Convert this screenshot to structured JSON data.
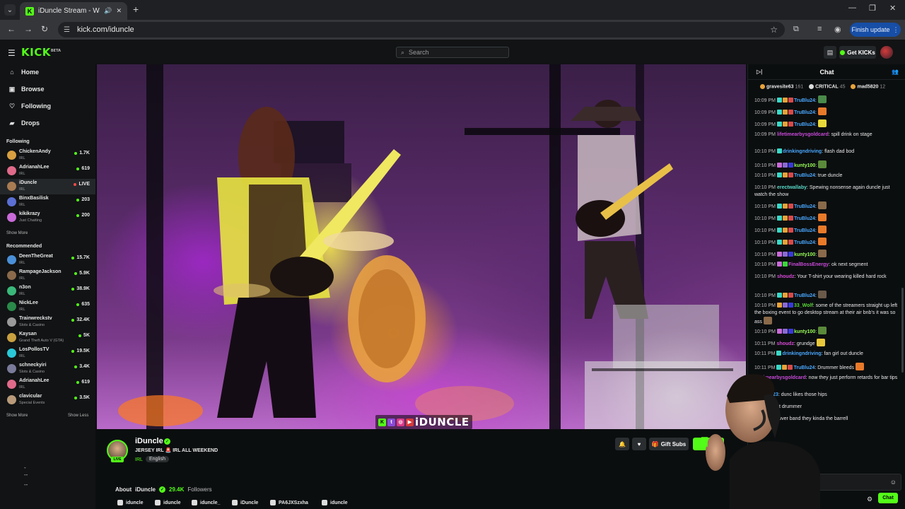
{
  "browser": {
    "tab_title": "iDuncle Stream - Watch Live",
    "url": "kick.com/iduncle",
    "finish_update": "Finish update"
  },
  "header": {
    "logo": "KICK",
    "logo_sup": "BETA",
    "search_placeholder": "Search",
    "get_kicks": "Get KICKs"
  },
  "sidebar": {
    "nav": [
      {
        "label": "Home",
        "icon": "home-icon"
      },
      {
        "label": "Browse",
        "icon": "browse-icon"
      },
      {
        "label": "Following",
        "icon": "heart-icon"
      },
      {
        "label": "Drops",
        "icon": "drops-icon"
      }
    ],
    "following_title": "Following",
    "following": [
      {
        "name": "ChickenAndy",
        "category": "IRL",
        "viewers": "1.7K",
        "color": "#d8a040"
      },
      {
        "name": "AdrianahLee",
        "category": "IRL",
        "viewers": "619",
        "color": "#e06a8a"
      },
      {
        "name": "iDuncle",
        "category": "IRL",
        "viewers": "LIVE",
        "color": "#a87b52",
        "active": true
      },
      {
        "name": "BinxBasilisk",
        "category": "IRL",
        "viewers": "203",
        "color": "#5b6fd4"
      },
      {
        "name": "kikikrazy",
        "category": "Just Chatting",
        "viewers": "200",
        "color": "#c86ad8"
      }
    ],
    "show_more_1": "Show More",
    "recommended_title": "Recommended",
    "recommended": [
      {
        "name": "DeenTheGreat",
        "category": "IRL",
        "viewers": "15.7K",
        "color": "#4a90d8"
      },
      {
        "name": "RampageJackson",
        "category": "IRL",
        "viewers": "5.9K",
        "color": "#8a6a4a"
      },
      {
        "name": "n3on",
        "category": "IRL",
        "viewers": "38.9K",
        "color": "#3ab87a"
      },
      {
        "name": "NickLee",
        "category": "IRL",
        "viewers": "635",
        "color": "#2a8a4a"
      },
      {
        "name": "Trainwreckstv",
        "category": "Slots & Casino",
        "viewers": "32.4K",
        "color": "#9a9a9a"
      },
      {
        "name": "Kaysan",
        "category": "Grand Theft Auto V (GTA)",
        "viewers": "5K",
        "color": "#c8a040"
      },
      {
        "name": "LosPollosTV",
        "category": "IRL",
        "viewers": "19.5K",
        "color": "#2ac8d8"
      },
      {
        "name": "schneckyiri",
        "category": "Slots & Casino",
        "viewers": "3.4K",
        "color": "#7a7a9a"
      },
      {
        "name": "AdrianahLee",
        "category": "IRL",
        "viewers": "619",
        "color": "#e06a8a"
      },
      {
        "name": "clavicular",
        "category": "Special Events",
        "viewers": "3.5K",
        "color": "#b89a7a"
      }
    ],
    "show_more_2": "Show More",
    "show_less": "Show Less"
  },
  "video": {
    "overlay_text": "iDUNCLE"
  },
  "streamer": {
    "name": "iDuncle",
    "live": "LIVE",
    "title": "JERSEY IRL 🚨 IRL ALL WEEKEND",
    "category": "IRL",
    "language": "English",
    "gift_subs": "Gift Subs",
    "about_prefix": "About",
    "followers_count": "29.4K",
    "followers_label": "Followers",
    "socials": [
      {
        "label": "iduncle",
        "icon": "kick-icon"
      },
      {
        "label": "iduncle",
        "icon": "instagram-icon"
      },
      {
        "label": "iduncle_",
        "icon": "x-icon"
      },
      {
        "label": "iDuncle",
        "icon": "youtube-icon"
      },
      {
        "label": "PA6JXSzxha",
        "icon": "discord-icon"
      },
      {
        "label": "iduncle",
        "icon": "tiktok-icon"
      }
    ]
  },
  "chat": {
    "title": "Chat",
    "leaderboard": [
      {
        "name": "gravesite63",
        "value": "161"
      },
      {
        "name": "CRITICAL",
        "value": "45"
      },
      {
        "name": "mad5820",
        "value": "12"
      }
    ],
    "messages": [
      {
        "time": "10:09 PM",
        "user": "TruBlu24",
        "color": "#4aa8ff",
        "text": ":",
        "emote": "#4a8a4a",
        "badges": [
          "#3ad8c8",
          "#e8a33a",
          "#d84a4a"
        ]
      },
      {
        "time": "10:09 PM",
        "user": "TruBlu24",
        "color": "#4aa8ff",
        "text": ":",
        "emote": "#e87a2a",
        "badges": [
          "#3ad8c8",
          "#e8a33a",
          "#d84a4a"
        ]
      },
      {
        "time": "10:09 PM",
        "user": "TruBlu24",
        "color": "#4aa8ff",
        "text": ":",
        "emote": "#e8d83a",
        "badges": [
          "#3ad8c8",
          "#e8a33a",
          "#d84a4a"
        ]
      },
      {
        "time": "10:09 PM",
        "user": "lifetimearbysgoldcard",
        "color": "#c84ad8",
        "text": ": spill drink on stage",
        "badges": []
      },
      {
        "time": "10:10 PM",
        "user": "drinkingndriving",
        "color": "#4aa8ff",
        "text": ": flash dad bod",
        "badges": [
          "#3ad8c8"
        ]
      },
      {
        "time": "10:10 PM",
        "user": "kunty100",
        "color": "#9aff5a",
        "text": ":",
        "emote": "#5a8a3a",
        "badges": [
          "#c86ad8",
          "#8a6ad8",
          "#3a3ad8"
        ]
      },
      {
        "time": "10:10 PM",
        "user": "TruBlu24",
        "color": "#4aa8ff",
        "text": ": true duncle",
        "badges": [
          "#3ad8c8",
          "#e8a33a",
          "#d84a4a"
        ]
      },
      {
        "time": "10:10 PM",
        "user": "erectwallaby",
        "color": "#5ad8c8",
        "text": ": Spewing nonsense again duncle just watch the show",
        "badges": []
      },
      {
        "time": "10:10 PM",
        "user": "TruBlu24",
        "color": "#4aa8ff",
        "text": ":",
        "emote": "#8a6a4a",
        "badges": [
          "#3ad8c8",
          "#e8a33a",
          "#d84a4a"
        ]
      },
      {
        "time": "10:10 PM",
        "user": "TruBlu24",
        "color": "#4aa8ff",
        "text": ":",
        "emote": "#e87a2a",
        "badges": [
          "#3ad8c8",
          "#e8a33a",
          "#d84a4a"
        ]
      },
      {
        "time": "10:10 PM",
        "user": "TruBlu24",
        "color": "#4aa8ff",
        "text": ":",
        "emote": "#e87a2a",
        "badges": [
          "#3ad8c8",
          "#e8a33a",
          "#d84a4a"
        ]
      },
      {
        "time": "10:10 PM",
        "user": "TruBlu24",
        "color": "#4aa8ff",
        "text": ":",
        "emote": "#e87a2a",
        "badges": [
          "#3ad8c8",
          "#e8a33a",
          "#d84a4a"
        ]
      },
      {
        "time": "10:10 PM",
        "user": "kunty100",
        "color": "#9aff5a",
        "text": ":",
        "emote": "#8a6a4a",
        "badges": [
          "#c86ad8",
          "#8a6ad8",
          "#3a3ad8"
        ]
      },
      {
        "time": "10:10 PM",
        "user": "FinalBossEnergy",
        "color": "#c84ad8",
        "text": ": ok next segment",
        "badges": [
          "#c86ad8",
          "#3ad83a"
        ]
      },
      {
        "time": "10:10 PM",
        "user": "shoudz",
        "color": "#d84ad8",
        "text": ": Your T-shirt your wearing killed hard rock",
        "badges": []
      },
      {
        "time": "10:10 PM",
        "user": "TruBlu24",
        "color": "#4aa8ff",
        "text": ":",
        "emote": "#6a5a4a",
        "badges": [
          "#3ad8c8",
          "#e8a33a",
          "#d84a4a"
        ]
      },
      {
        "time": "10:10 PM",
        "user": "33_Wolf",
        "color": "#5ad83a",
        "text": ": some of the streamers straight up left the boxing event to go desktop stream at their air bnb's it was so ass",
        "emote": "#8a6a4a",
        "badges": [
          "#e8a33a",
          "#8a6ad8",
          "#3a3ad8"
        ]
      },
      {
        "time": "10:10 PM",
        "user": "kunty100",
        "color": "#9aff5a",
        "text": ":",
        "emote": "#5a8a3a",
        "badges": [
          "#c86ad8",
          "#8a6ad8",
          "#3a3ad8"
        ]
      },
      {
        "time": "10:11 PM",
        "user": "shoudz",
        "color": "#d84ad8",
        "text": ": grundge",
        "emote": "#e8c83a",
        "badges": []
      },
      {
        "time": "10:11 PM",
        "user": "drinkingndriving",
        "color": "#4aa8ff",
        "text": ": fan girl out duncle",
        "badges": [
          "#3ad8c8"
        ]
      },
      {
        "time": "10:11 PM",
        "user": "TruBlu24",
        "color": "#4aa8ff",
        "text": ": Drummer bleeds",
        "emote": "#e87a2a",
        "badges": [
          "#3ad8c8",
          "#e8a33a",
          "#d84a4a"
        ]
      },
      {
        "time": "",
        "user": "lifetimearbysgoldcard",
        "color": "#c84ad8",
        "text": ": now they just perform retards for bar tips",
        "badges": []
      },
      {
        "time": "",
        "user": "Jwoods23",
        "color": "#4aa8ff",
        "text": ": dunc likes those hips",
        "badges": []
      },
      {
        "time": "",
        "user": "",
        "color": "#4aa8ff",
        "text": "solid pocket drummer",
        "badges": []
      },
      {
        "time": "",
        "user": "",
        "color": "#4aa8ff",
        "text": "mean it a cover band they kinda the barrell",
        "badges": []
      }
    ],
    "send": "Chat"
  },
  "colors": {
    "accent": "#53fc18",
    "background": "#0b0e0f",
    "panel": "#111314"
  }
}
